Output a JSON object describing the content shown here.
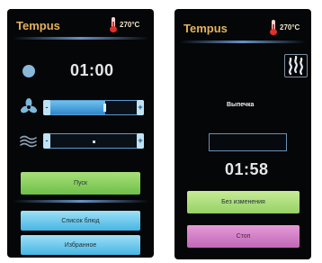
{
  "left_screen": {
    "brand": "Tempus",
    "temperature": "270°C",
    "timer": "01:00",
    "fan_level": 0.62,
    "humidity_level": 0.5,
    "slider_decrease_glyph": "-",
    "slider_increase_glyph": "+",
    "start_button": "Пуск",
    "recipes_button": "Список блюд",
    "favorites_button": "Избранное"
  },
  "right_screen": {
    "brand": "Tempus",
    "temperature": "270°C",
    "status": "Выпечка",
    "timer": "01:58",
    "no_change_button": "Без изменения",
    "stop_button": "Стоп"
  },
  "icons": {
    "timer": "circle-icon",
    "fan": "fan-icon",
    "humidity": "wave-icon",
    "temperature": "thermometer-icon",
    "mode": "steam-icon"
  },
  "colors": {
    "brand": "#e3b25a",
    "screen_bg": "#050608",
    "green_button": "#7ec850",
    "blue_button": "#45b5e3",
    "magenta_button": "#c068b8",
    "slider_fill": "#3a94d4"
  }
}
